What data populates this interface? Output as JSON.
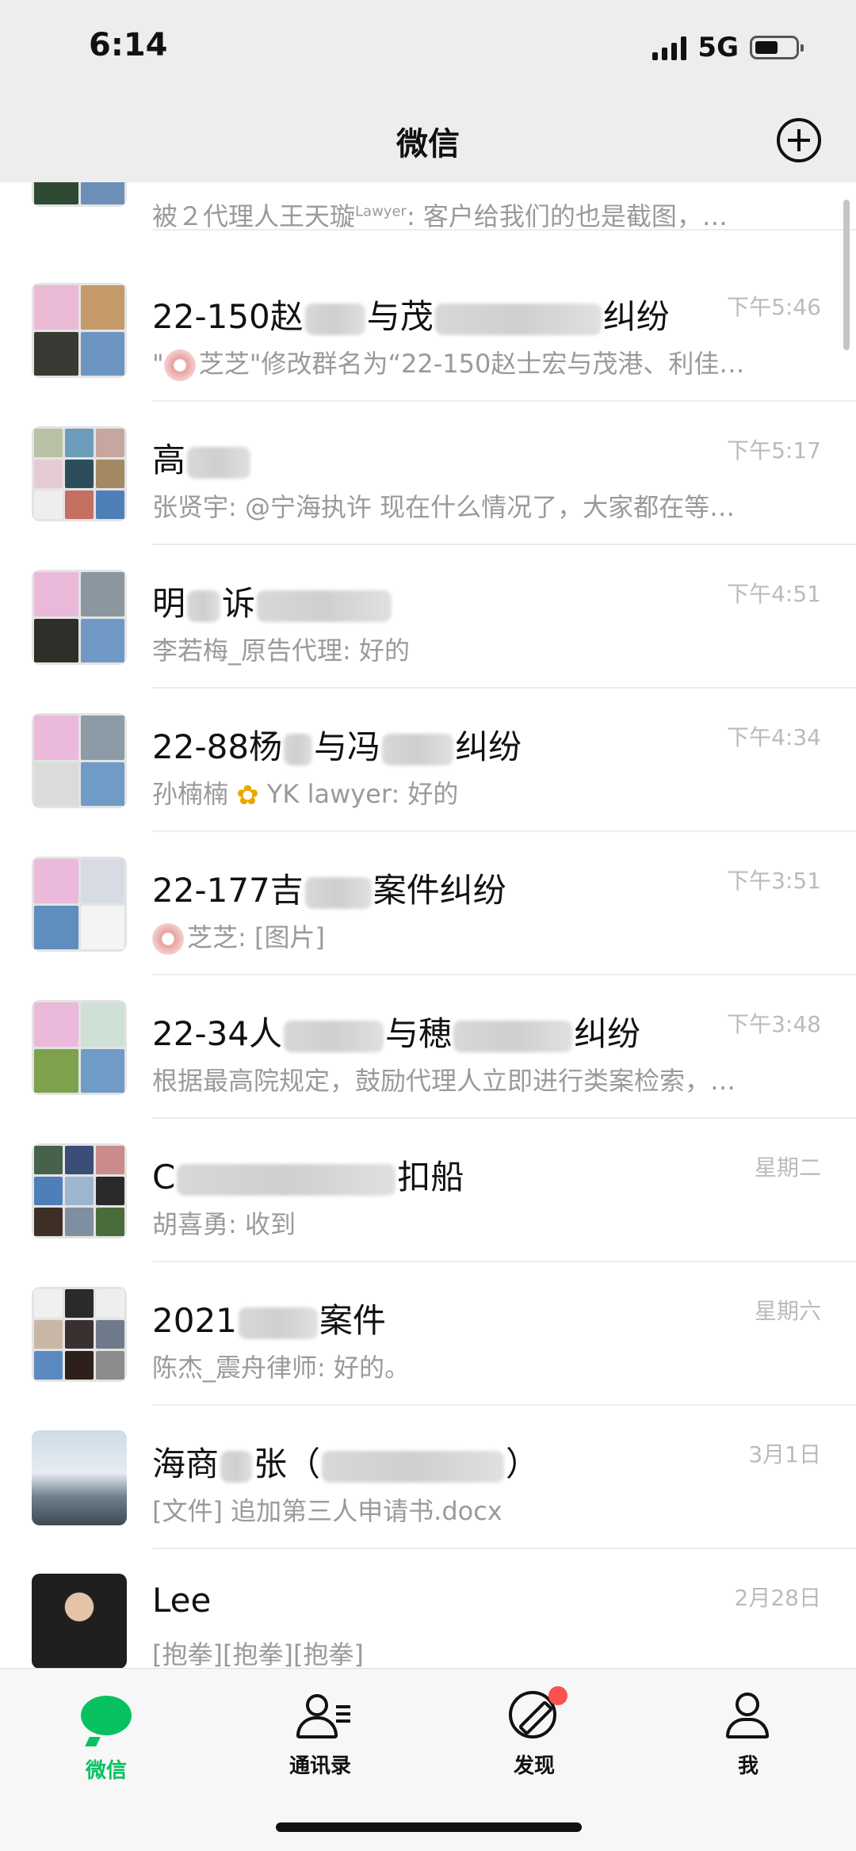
{
  "status": {
    "time": "6:14",
    "network": "5G",
    "battery_percent": 40
  },
  "header": {
    "title": "微信",
    "add_icon": "plus-circle-icon"
  },
  "chats": [
    {
      "name": "",
      "preview_a": "被２代理人王天璇",
      "preview_sup": "Lawyer",
      "preview_b": ": 客户给我们的也是截图，…",
      "time": ""
    },
    {
      "name_a": "22-150赵",
      "name_b": "与茂",
      "name_c": "纠纷",
      "preview_a": "\"",
      "preview_b": "芝芝\"修改群名为“22-150赵士宏与茂港、利佳…",
      "time": "下午5:46"
    },
    {
      "name_a": "高",
      "preview": "张贤宇: @宁海执许 现在什么情况了，大家都在等…",
      "time": "下午5:17"
    },
    {
      "name_a": "明",
      "name_b": "诉",
      "preview": "李若梅_原告代理: 好的",
      "time": "下午4:51"
    },
    {
      "name_a": "22-88杨",
      "name_b": "与冯",
      "name_c": "纠纷",
      "preview_a": "孙楠楠",
      "preview_b": "YK lawyer: 好的",
      "time": "下午4:34"
    },
    {
      "name_a": "22-177吉",
      "name_b": "案件纠纷",
      "preview_b": "芝芝: [图片]",
      "time": "下午3:51"
    },
    {
      "name_a": "22-34人",
      "name_b": "与穂",
      "name_c": "纠纷",
      "preview": "根据最高院规定，鼓励代理人立即进行类案检索，…",
      "time": "下午3:48"
    },
    {
      "name_a": "C",
      "name_b": "扣船",
      "preview": "胡喜勇: 收到",
      "time": "星期二"
    },
    {
      "name_a": "2021",
      "name_b": "案件",
      "preview": "陈杰_震舟律师: 好的。",
      "time": "星期六"
    },
    {
      "name_a": "海商",
      "name_b": "张（",
      "name_c": "）",
      "preview": "[文件] 追加第三人申请书.docx",
      "time": "3月1日"
    },
    {
      "name_a": "Lee",
      "preview": "[抱拳][抱拳][抱拳]",
      "time": "2月28日"
    }
  ],
  "tabs": [
    {
      "label": "微信",
      "icon": "chat-bubble-icon",
      "active": true
    },
    {
      "label": "通讯录",
      "icon": "contacts-icon",
      "active": false
    },
    {
      "label": "发现",
      "icon": "compass-icon",
      "active": false,
      "badge": true
    },
    {
      "label": "我",
      "icon": "person-icon",
      "active": false
    }
  ],
  "colors": {
    "accent": "#07c160",
    "badge": "#fa5151",
    "background": "#ededed"
  }
}
